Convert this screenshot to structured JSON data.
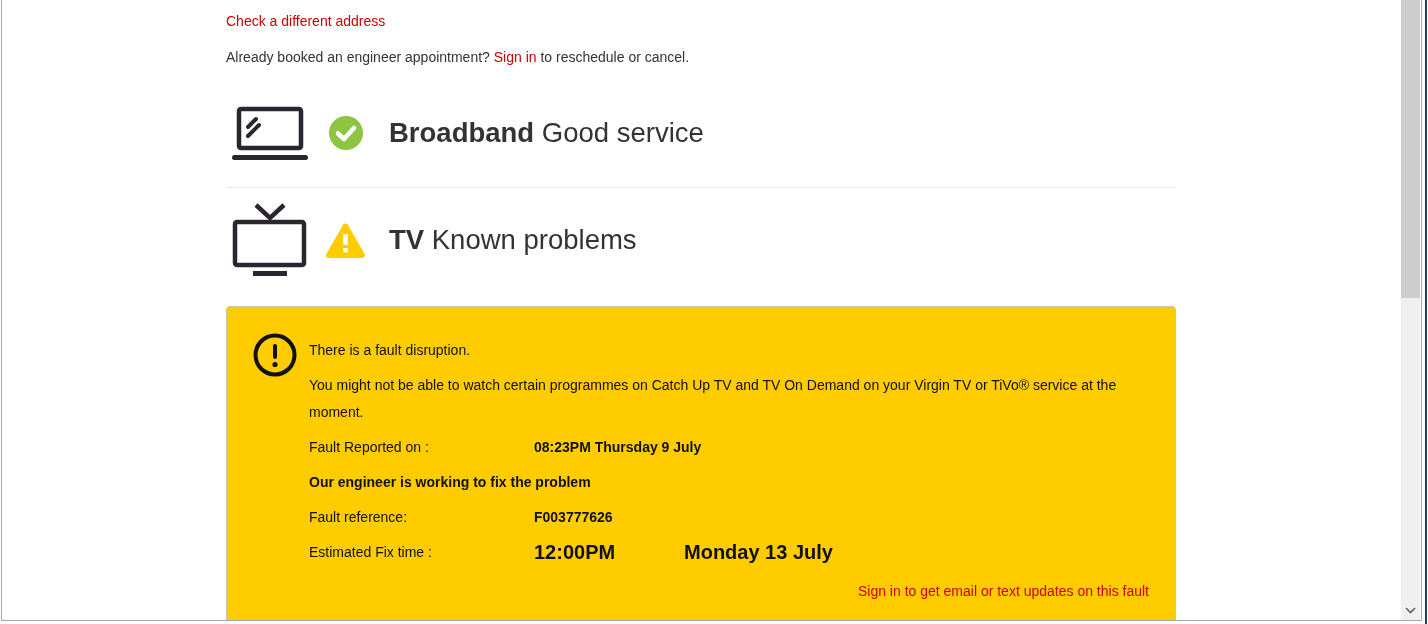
{
  "address_link": "Check a different address",
  "appointment_note": {
    "before": "Already booked an engineer appointment?",
    "link": "Sign in",
    "after": "to reschedule or cancel."
  },
  "services": [
    {
      "kind": "broadband",
      "ok": true,
      "heading": "**Broadband** Good service"
    },
    {
      "kind": "tv",
      "ok": false,
      "heading": "**TV** Known problems"
    }
  ],
  "fault": {
    "title": "There is a fault disruption.",
    "description": "You might not be able to watch certain programmes on Catch Up TV and TV On Demand on your Virgin TV or TiVo® service at the moment.",
    "details": [
      {
        "kind": "field",
        "label": "Fault Reported on :",
        "value": "08:23PM Thursday 9 July"
      },
      {
        "kind": "notice",
        "text": "Our engineer is working to fix the problem"
      },
      {
        "kind": "field",
        "label": "Fault reference:",
        "value": "F003777626"
      },
      {
        "kind": "estimate",
        "label": "Estimated Fix time :",
        "time": "12:00PM",
        "date": "Monday 13 July"
      }
    ],
    "updates_link": "Sign in to get email or text updates on this fault"
  }
}
